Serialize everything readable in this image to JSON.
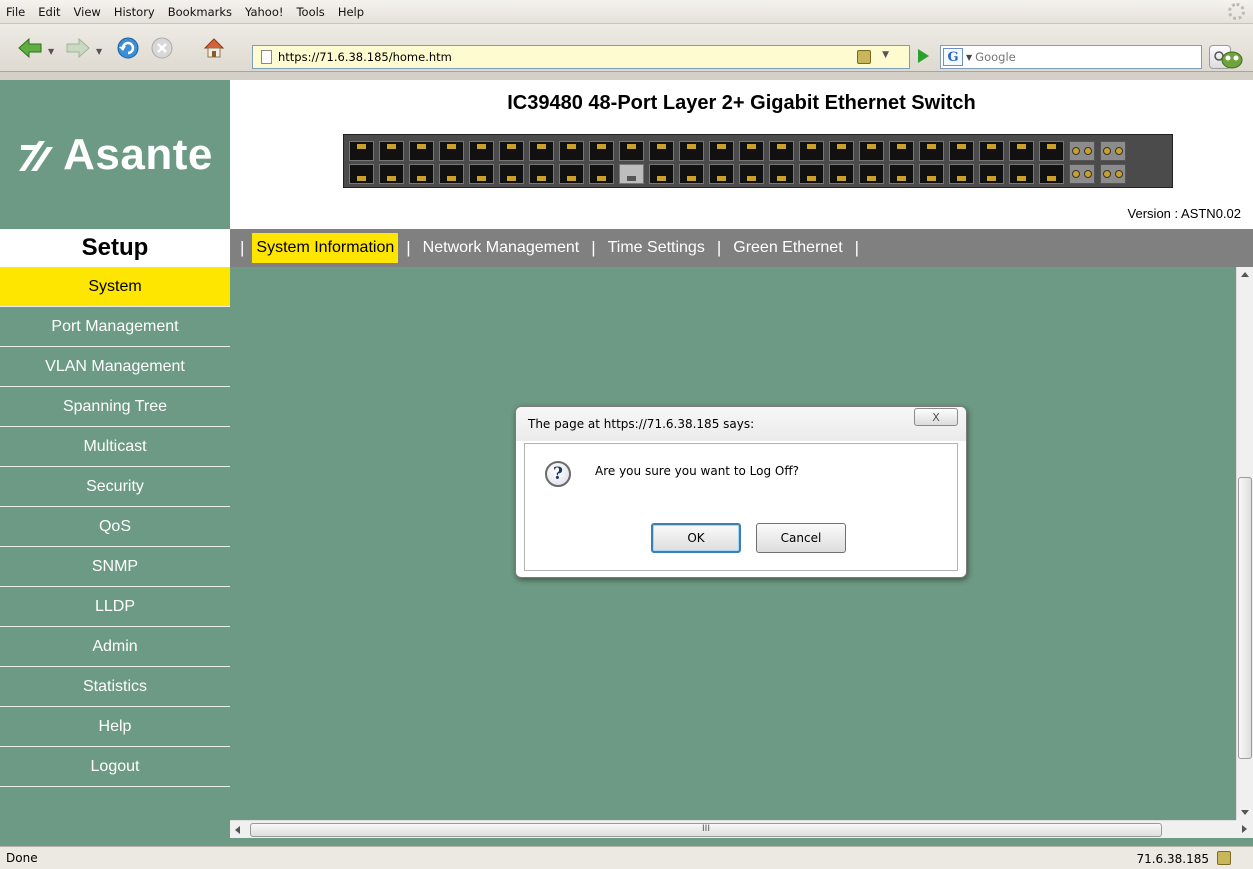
{
  "browser": {
    "menu": [
      "File",
      "Edit",
      "View",
      "History",
      "Bookmarks",
      "Yahoo!",
      "Tools",
      "Help"
    ],
    "url": "https://71.6.38.185/home.htm",
    "search_placeholder": "Google",
    "search_engine_letter": "G",
    "status": "Done",
    "status_host": "71.6.38.185"
  },
  "logo": {
    "text": "Asante"
  },
  "header": {
    "title": "IC39480 48-Port Layer 2+ Gigabit Ethernet Switch",
    "version": "Version : ASTN0.02"
  },
  "sidebar": {
    "heading": "Setup",
    "items": [
      {
        "label": "System",
        "active": true
      },
      {
        "label": "Port Management"
      },
      {
        "label": "VLAN Management"
      },
      {
        "label": "Spanning Tree"
      },
      {
        "label": "Multicast"
      },
      {
        "label": "Security"
      },
      {
        "label": "QoS"
      },
      {
        "label": "SNMP"
      },
      {
        "label": "LLDP"
      },
      {
        "label": "Admin"
      },
      {
        "label": "Statistics"
      },
      {
        "label": "Help"
      },
      {
        "label": "Logout"
      }
    ]
  },
  "tabs": [
    {
      "label": "System Information",
      "active": true
    },
    {
      "label": "Network Management"
    },
    {
      "label": "Time Settings"
    },
    {
      "label": "Green Ethernet"
    }
  ],
  "hscroll_label": "III",
  "dialog": {
    "title": "The page at https://71.6.38.185 says:",
    "close_label": "X",
    "message": "Are you sure you want to Log Off?",
    "ok_label": "OK",
    "cancel_label": "Cancel",
    "icon_glyph": "?"
  },
  "colors": {
    "brand_green": "#6d9a84",
    "active_yellow": "#ffe600",
    "tab_gray": "#808080"
  }
}
